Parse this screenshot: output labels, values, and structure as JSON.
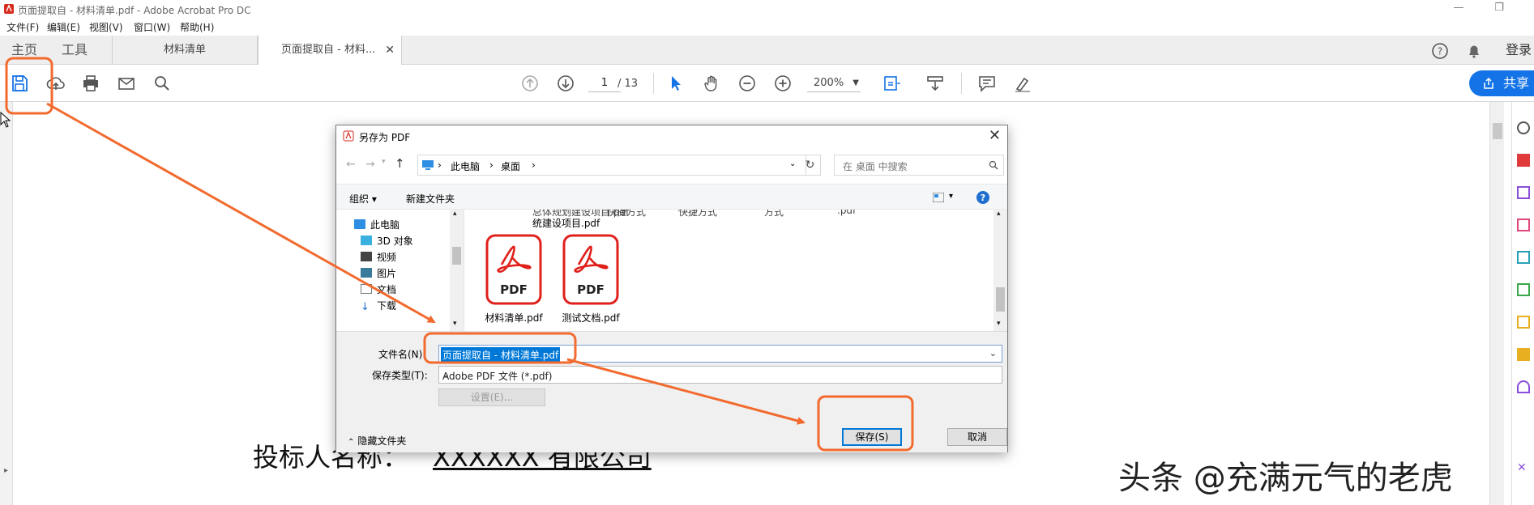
{
  "window": {
    "title": "页面提取自 - 材料清单.pdf - Adobe Acrobat Pro DC",
    "controls": [
      "—",
      "❐",
      "✕"
    ]
  },
  "menu": [
    "文件(F)",
    "编辑(E)",
    "视图(V)",
    "窗口(W)",
    "帮助(H)"
  ],
  "tabs": {
    "home": "主页",
    "tools": "工具",
    "doc1": "材料清单",
    "doc2": "页面提取自 - 材料...",
    "close": "✕",
    "login": "登录"
  },
  "toolbar": {
    "page_current": "1",
    "page_total": "/ 13",
    "zoom": "200%",
    "share": "共享"
  },
  "document": {
    "bidder_label": "投标人名称：",
    "bidder_value": "XXXXXX 有限公司"
  },
  "watermark": "头条 @充满元气的老虎",
  "dialog": {
    "title": "另存为 PDF",
    "breadcrumb": [
      "此电脑",
      "桌面"
    ],
    "search_placeholder": "在 桌面 中搜索",
    "organize": "组织 ▾",
    "new_folder": "新建文件夹",
    "nav_items": [
      "此电脑",
      "3D 对象",
      "视频",
      "图片",
      "文档",
      "下载"
    ],
    "partial_items": [
      "总体规划建设项目.pdf",
      "统建设项目.pdf",
      "快捷方式",
      "快捷方式",
      "方式",
      ".pdf"
    ],
    "files": [
      {
        "name": "材料清单.pdf",
        "icon_text": "PDF"
      },
      {
        "name": "测试文档.pdf",
        "icon_text": "PDF"
      }
    ],
    "filename_label": "文件名(N):",
    "filename_value": "页面提取自 - 材料清单.pdf",
    "filetype_label": "保存类型(T):",
    "filetype_value": "Adobe PDF 文件 (*.pdf)",
    "settings": "设置(E)...",
    "hide_folders": "隐藏文件夹",
    "save": "保存(S)",
    "cancel": "取消"
  },
  "colors": {
    "accent": "#1473e6",
    "annotation": "#f26a2e",
    "pdf_red": "#e0201b"
  }
}
